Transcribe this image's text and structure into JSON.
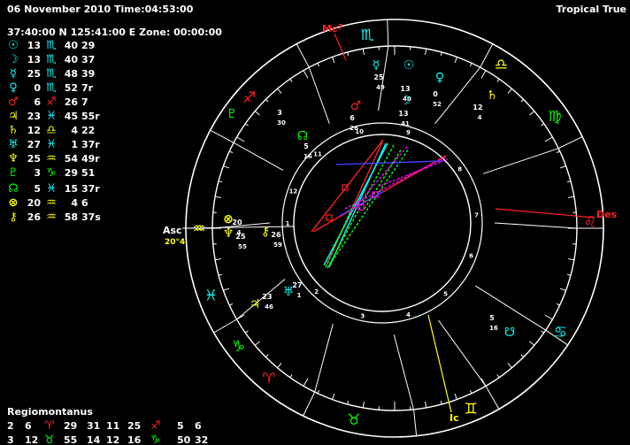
{
  "header": {
    "datetime": "06 November 2010 Time:04:53:00",
    "location": "37:40:00 N 125:41:00 E Zone: 00:00:00",
    "zodiac": "Tropical True"
  },
  "positions": [
    {
      "glyph": "☉",
      "deg": "13",
      "sign": "♏",
      "min": "40",
      "sec": "29",
      "color": "#00ffff",
      "sign_color": "#00ffff"
    },
    {
      "glyph": "☽",
      "deg": "13",
      "sign": "♏",
      "min": "40",
      "sec": "37",
      "color": "#00ffff",
      "sign_color": "#00ffff"
    },
    {
      "glyph": "☿",
      "deg": "25",
      "sign": "♏",
      "min": "48",
      "sec": "39",
      "color": "#00ffff",
      "sign_color": "#00ffff"
    },
    {
      "glyph": "♀",
      "deg": "0",
      "sign": "♏",
      "min": "52",
      "sec": "7r",
      "color": "#00ffff",
      "sign_color": "#00ffff"
    },
    {
      "glyph": "♂",
      "deg": "6",
      "sign": "♐",
      "min": "26",
      "sec": "7",
      "color": "#ff2020",
      "sign_color": "#ff2020"
    },
    {
      "glyph": "♃",
      "deg": "23",
      "sign": "♓",
      "min": "45",
      "sec": "55r",
      "color": "#ffff00",
      "sign_color": "#00ffff"
    },
    {
      "glyph": "♄",
      "deg": "12",
      "sign": "♎",
      "min": "4",
      "sec": "22",
      "color": "#ffff00",
      "sign_color": "#ffff00"
    },
    {
      "glyph": "♅",
      "deg": "27",
      "sign": "♓",
      "min": "1",
      "sec": "37r",
      "color": "#00ffff",
      "sign_color": "#00ffff"
    },
    {
      "glyph": "♆",
      "deg": "25",
      "sign": "♒",
      "min": "54",
      "sec": "49r",
      "color": "#ffff00",
      "sign_color": "#ffff00"
    },
    {
      "glyph": "♇",
      "deg": "3",
      "sign": "♑",
      "min": "29",
      "sec": "51",
      "color": "#00ff00",
      "sign_color": "#00ff00"
    },
    {
      "glyph": "☊",
      "deg": "5",
      "sign": "♓",
      "min": "15",
      "sec": "37r",
      "color": "#00ff00",
      "sign_color": "#00ffff"
    },
    {
      "glyph": "⊗",
      "deg": "20",
      "sign": "♒",
      "min": "4",
      "sec": "6",
      "color": "#ffff00",
      "sign_color": "#ffff00"
    },
    {
      "glyph": "⚷",
      "deg": "26",
      "sign": "♒",
      "min": "58",
      "sec": "37s",
      "color": "#ffff00",
      "sign_color": "#ffff00"
    }
  ],
  "house_system": {
    "title": "Regiomontanus",
    "rows": [
      [
        {
          "t": "2",
          "c": "#ffffff"
        },
        {
          "t": "6",
          "c": "#ffffff"
        },
        {
          "t": "♈",
          "c": "#ff2020"
        },
        {
          "t": "29",
          "c": "#ffffff"
        },
        {
          "t": "31",
          "c": "#ffffff"
        },
        {
          "t": "11",
          "c": "#ffffff"
        },
        {
          "t": "25",
          "c": "#ffffff"
        },
        {
          "t": "♐",
          "c": "#ff2020"
        },
        {
          "t": "5",
          "c": "#ffffff"
        },
        {
          "t": "6",
          "c": "#ffffff"
        }
      ],
      [
        {
          "t": "3",
          "c": "#ffffff"
        },
        {
          "t": "12",
          "c": "#ffffff"
        },
        {
          "t": "♉",
          "c": "#00ff00"
        },
        {
          "t": "55",
          "c": "#ffffff"
        },
        {
          "t": "14",
          "c": "#ffffff"
        },
        {
          "t": "12",
          "c": "#ffffff"
        },
        {
          "t": "16",
          "c": "#ffffff"
        },
        {
          "t": "♑",
          "c": "#00ff00"
        },
        {
          "t": "50",
          "c": "#ffffff"
        },
        {
          "t": "32",
          "c": "#ffffff"
        }
      ]
    ]
  },
  "wheel": {
    "angle_labels": {
      "mc": "Mc",
      "mc_deg": "7",
      "asc": "Asc",
      "asc_deg": "20°4",
      "des": "Des",
      "ic": "Ic"
    },
    "house_numbers": [
      "1",
      "2",
      "3",
      "4",
      "5",
      "6",
      "7",
      "8",
      "9",
      "10",
      "11",
      "12"
    ],
    "signs": [
      {
        "glyph": "♒",
        "color": "#ffff00"
      },
      {
        "glyph": "♑",
        "color": "#00ff00"
      },
      {
        "glyph": "♐",
        "color": "#ff2020"
      },
      {
        "glyph": "♏",
        "color": "#00ffff"
      },
      {
        "glyph": "♎",
        "color": "#ffff00"
      },
      {
        "glyph": "♍",
        "color": "#00ff00"
      },
      {
        "glyph": "♌",
        "color": "#ff2020"
      },
      {
        "glyph": "♋",
        "color": "#00ffff"
      },
      {
        "glyph": "♊",
        "color": "#ffff00"
      },
      {
        "glyph": "♉",
        "color": "#00ff00"
      },
      {
        "glyph": "♈",
        "color": "#ff2020"
      },
      {
        "glyph": "♓",
        "color": "#00ffff"
      }
    ],
    "planets": [
      {
        "glyph": "☿",
        "color": "#00ffff",
        "deg": "25",
        "min": "49"
      },
      {
        "glyph": "☉",
        "color": "#00ffff",
        "deg": "13",
        "min": "40"
      },
      {
        "glyph": "♀",
        "color": "#00ffff",
        "deg": "0",
        "min": "52"
      },
      {
        "glyph": "☽",
        "color": "#00ffff",
        "deg": "13",
        "min": "41"
      },
      {
        "glyph": "♄",
        "color": "#ffff00",
        "deg": "12",
        "min": "4"
      },
      {
        "glyph": "♂",
        "color": "#ff2020",
        "deg": "6",
        "min": "26"
      },
      {
        "glyph": "♇",
        "color": "#00ff00",
        "deg": "3",
        "min": "30"
      },
      {
        "glyph": "☊",
        "color": "#00ff00",
        "deg": "5",
        "min": "16"
      },
      {
        "glyph": "⊗",
        "color": "#ffff00",
        "deg": "20",
        "min": "4"
      },
      {
        "glyph": "♆",
        "color": "#ffff00",
        "deg": "25",
        "min": "55"
      },
      {
        "glyph": "⚷",
        "color": "#ffff00",
        "deg": "26",
        "min": "59"
      },
      {
        "glyph": "♅",
        "color": "#00ffff",
        "deg": "27",
        "min": "1"
      },
      {
        "glyph": "♃",
        "color": "#ffff00",
        "deg": "23",
        "min": "46"
      },
      {
        "glyph": "☋",
        "color": "#00ffff",
        "deg": "5",
        "min": "16"
      }
    ]
  }
}
